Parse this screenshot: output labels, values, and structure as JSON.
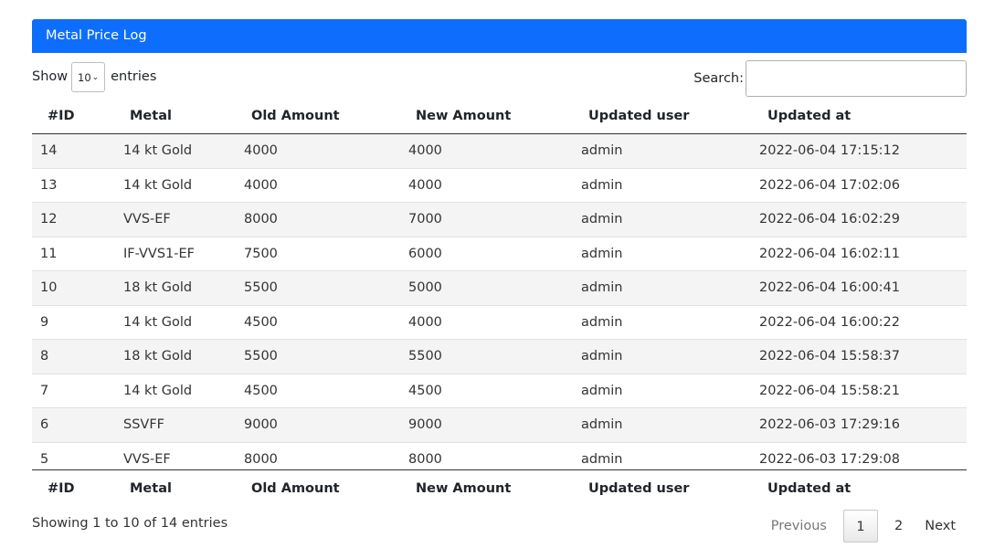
{
  "card": {
    "title": "Metal Price Log"
  },
  "length": {
    "prefix": "Show",
    "value": "10",
    "suffix": "entries"
  },
  "search": {
    "label": "Search:",
    "value": ""
  },
  "table": {
    "headers": [
      "#ID",
      "Metal",
      "Old Amount",
      "New Amount",
      "Updated user",
      "Updated at"
    ],
    "rows": [
      [
        "14",
        "14 kt Gold",
        "4000",
        "4000",
        "admin",
        "2022-06-04 17:15:12"
      ],
      [
        "13",
        "14 kt Gold",
        "4000",
        "4000",
        "admin",
        "2022-06-04 17:02:06"
      ],
      [
        "12",
        "VVS-EF",
        "8000",
        "7000",
        "admin",
        "2022-06-04 16:02:29"
      ],
      [
        "11",
        "IF-VVS1-EF",
        "7500",
        "6000",
        "admin",
        "2022-06-04 16:02:11"
      ],
      [
        "10",
        "18 kt Gold",
        "5500",
        "5000",
        "admin",
        "2022-06-04 16:00:41"
      ],
      [
        "9",
        "14 kt Gold",
        "4500",
        "4000",
        "admin",
        "2022-06-04 16:00:22"
      ],
      [
        "8",
        "18 kt Gold",
        "5500",
        "5500",
        "admin",
        "2022-06-04 15:58:37"
      ],
      [
        "7",
        "14 kt Gold",
        "4500",
        "4500",
        "admin",
        "2022-06-04 15:58:21"
      ],
      [
        "6",
        "SSVFF",
        "9000",
        "9000",
        "admin",
        "2022-06-03 17:29:16"
      ],
      [
        "5",
        "VVS-EF",
        "8000",
        "8000",
        "admin",
        "2022-06-03 17:29:08"
      ]
    ]
  },
  "footer": {
    "info": "Showing 1 to 10 of 14 entries",
    "pagination": {
      "previous": "Previous",
      "pages": [
        "1",
        "2"
      ],
      "current": "1",
      "next": "Next"
    }
  },
  "colors": {
    "header_bg": "#0d6efd",
    "header_text": "#ffffff",
    "stripe": "#f4f4f4"
  }
}
